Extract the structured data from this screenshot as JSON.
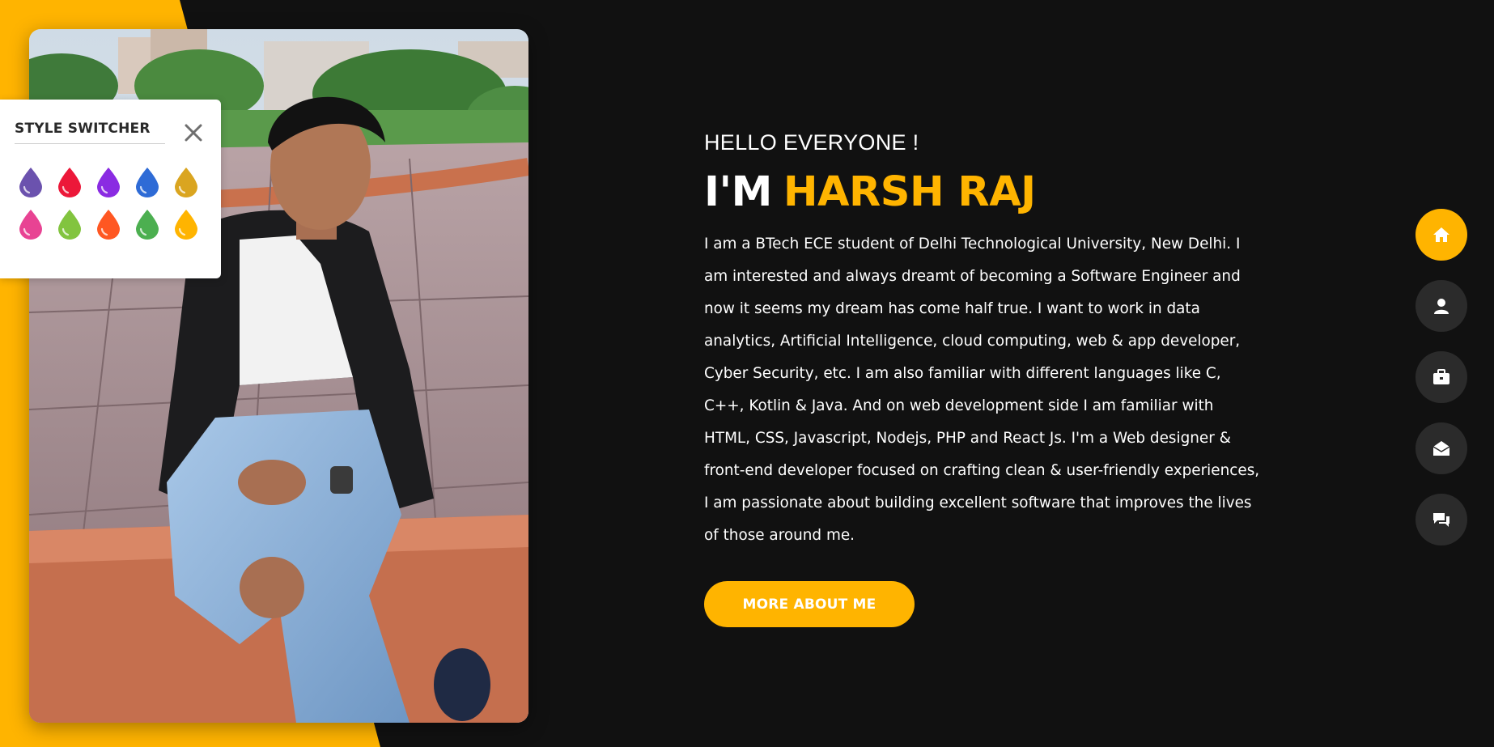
{
  "colors": {
    "accent": "#ffb400",
    "background": "#111111",
    "nav_button": "#2b2b2b",
    "panel": "#ffffff",
    "swatches": [
      "#6b52ae",
      "#ec1839",
      "#8a2be2",
      "#2e6bd6",
      "#daa520",
      "#e84393",
      "#82c43f",
      "#ff5722",
      "#4caf50",
      "#ffb400"
    ]
  },
  "style_switcher": {
    "title": "STYLE SWITCHER",
    "close_icon": "close-icon"
  },
  "intro": {
    "greeting": "HELLO EVERYONE !",
    "im": "I'M",
    "name": "HARSH RAJ",
    "bio": "I am a BTech ECE student of Delhi Technological University, New Delhi. I am interested and always dreamt of becoming a Software Engineer and now it seems my dream has come half true. I want to work in data analytics, Artificial Intelligence, cloud computing, web & app developer, Cyber Security, etc. I am also familiar with different languages like C, C++, Kotlin & Java. And on web development side I am familiar with HTML, CSS, Javascript, Nodejs, PHP and React Js. I'm a Web designer & front-end developer focused on crafting clean & user-friendly experiences, I am passionate about building excellent software that improves the lives of those around me.",
    "cta": "MORE ABOUT ME"
  },
  "side_nav": {
    "items": [
      {
        "icon": "home-icon",
        "active": true
      },
      {
        "icon": "user-icon",
        "active": false
      },
      {
        "icon": "briefcase-icon",
        "active": false
      },
      {
        "icon": "envelope-open-icon",
        "active": false
      },
      {
        "icon": "comments-icon",
        "active": false
      }
    ]
  }
}
